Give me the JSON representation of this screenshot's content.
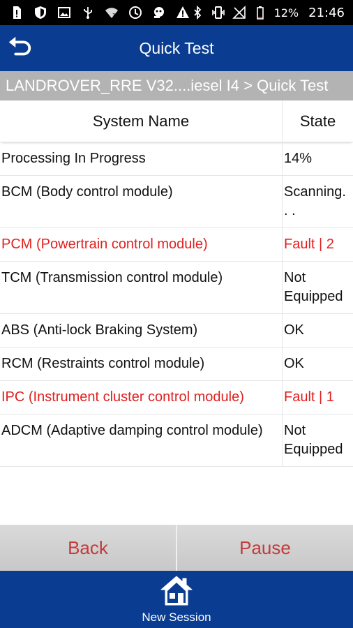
{
  "status_bar": {
    "battery_percent": "12%",
    "time": "21:46",
    "icons_left": [
      "sim-alert-icon",
      "shield-icon",
      "image-icon",
      "usb-icon",
      "wifi-question-icon",
      "sync-icon",
      "hand-icon",
      "warning-icon"
    ],
    "icons_right": [
      "bluetooth-icon",
      "vibrate-icon",
      "no-signal-icon",
      "battery-icon"
    ]
  },
  "app_bar": {
    "title": "Quick Test",
    "back_icon": "back-arrow-icon",
    "color": "#0a3d91"
  },
  "breadcrumb": "LANDROVER_RRE V32....iesel I4 > Quick Test",
  "table": {
    "headers": [
      "System Name",
      "State"
    ],
    "rows": [
      {
        "name": "Processing In Progress",
        "state": "14%",
        "fault": false
      },
      {
        "name": "BCM (Body control module)",
        "state": "Scanning. . .",
        "fault": false
      },
      {
        "name": "PCM (Powertrain control module)",
        "state": "Fault | 2",
        "fault": true
      },
      {
        "name": "TCM (Transmission control module)",
        "state": "Not Equipped",
        "fault": false
      },
      {
        "name": "ABS (Anti-lock Braking System)",
        "state": "OK",
        "fault": false
      },
      {
        "name": "RCM (Restraints control module)",
        "state": "OK",
        "fault": false
      },
      {
        "name": "IPC (Instrument cluster control module)",
        "state": "Fault | 1",
        "fault": true
      },
      {
        "name": "ADCM (Adaptive damping control module)",
        "state": "Not Equipped",
        "fault": false
      }
    ],
    "fault_color": "#e12020"
  },
  "buttons": {
    "back": "Back",
    "pause": "Pause"
  },
  "bottom_nav": {
    "label": "New Session",
    "icon": "home-icon"
  }
}
